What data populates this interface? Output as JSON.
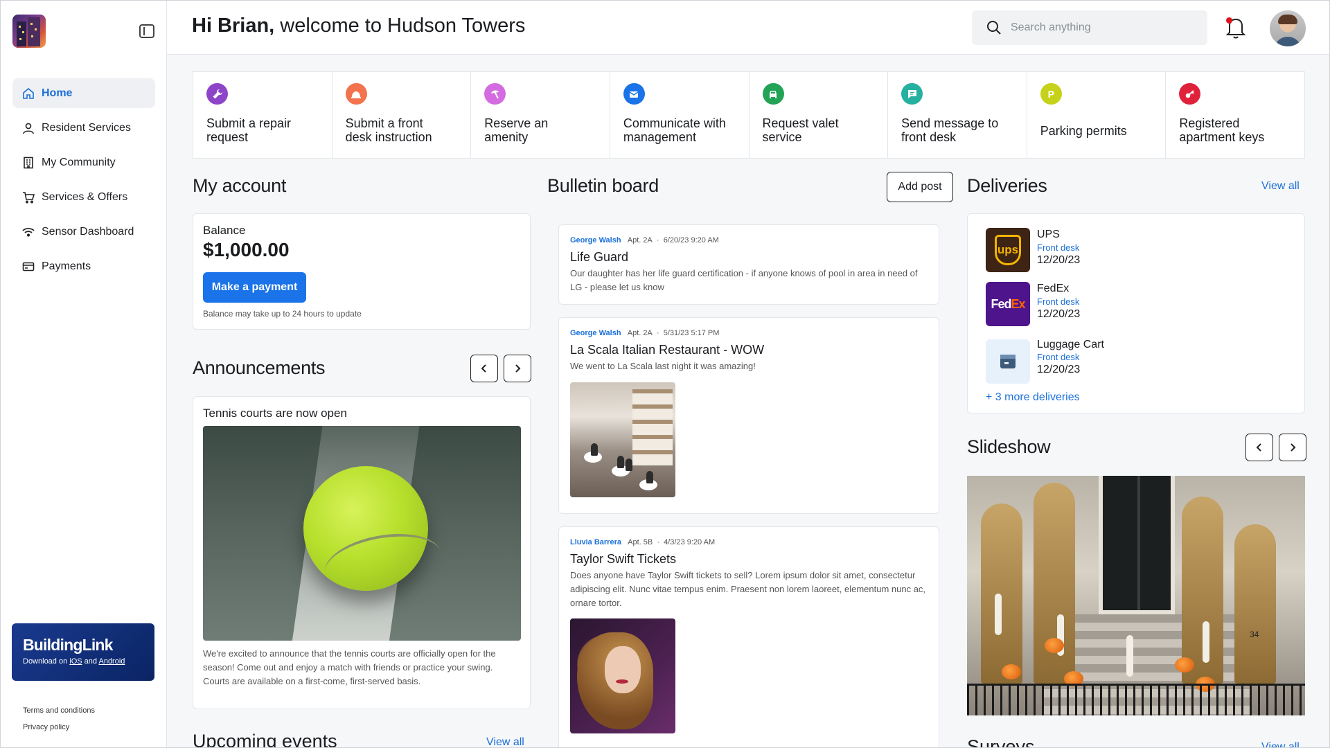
{
  "header": {
    "greeting_name": "Hi Brian,",
    "greeting_rest": " welcome to Hudson Towers",
    "search_placeholder": "Search anything"
  },
  "sidebar": {
    "items": [
      {
        "label": "Home",
        "icon": "home-icon",
        "active": true
      },
      {
        "label": "Resident Services",
        "icon": "person-icon"
      },
      {
        "label": "My Community",
        "icon": "building-icon"
      },
      {
        "label": "Services & Offers",
        "icon": "cart-icon"
      },
      {
        "label": "Sensor Dashboard",
        "icon": "wifi-icon"
      },
      {
        "label": "Payments",
        "icon": "card-icon"
      }
    ],
    "promo": {
      "title": "BuildingLink",
      "download_prefix": "Download on ",
      "ios": "iOS",
      "and": " and ",
      "android": "Android"
    },
    "legal": [
      "Terms and conditions",
      "Privacy policy"
    ]
  },
  "quick_actions": [
    {
      "label": "Submit a repair request",
      "color": "#8e44c9",
      "icon": "wrench-icon"
    },
    {
      "label": "Submit a front desk instruction",
      "color": "#f2734d",
      "icon": "bell-desk-icon"
    },
    {
      "label": "Reserve an amenity",
      "color": "#d46be0",
      "icon": "umbrella-icon"
    },
    {
      "label": "Communicate with management",
      "color": "#1a73e8",
      "icon": "mail-icon"
    },
    {
      "label": "Request valet service",
      "color": "#22a356",
      "icon": "car-icon"
    },
    {
      "label": "Send message to front desk",
      "color": "#26b0a0",
      "icon": "chat-icon"
    },
    {
      "label": "Parking permits",
      "color": "#c6d21a",
      "icon": "parking-icon",
      "glyph": "P"
    },
    {
      "label": "Registered apartment keys",
      "color": "#e0213a",
      "icon": "key-icon"
    }
  ],
  "account": {
    "title": "My account",
    "balance_label": "Balance",
    "balance": "$1,000.00",
    "pay_label": "Make a payment",
    "note": "Balance may take up to 24 hours to update"
  },
  "announcements": {
    "title": "Announcements",
    "item_title": "Tennis courts are now open",
    "item_text": "We're excited to announce that the tennis courts are officially open for the season! Come out and enjoy a match with friends or practice your swing. Courts are available on a first-come, first-served basis."
  },
  "upcoming": {
    "title": "Upcoming events",
    "view_all": "View all"
  },
  "bulletin": {
    "title": "Bulletin board",
    "add_label": "Add post",
    "posts": [
      {
        "author": "George Walsh",
        "apt": "Apt. 2A",
        "date": "6/20/23 9:20 AM",
        "title": "Life Guard",
        "body": "Our daughter has her life guard certification - if anyone knows of pool in area in need of LG - please let us know"
      },
      {
        "author": "George Walsh",
        "apt": "Apt. 2A",
        "date": "5/31/23 5:17 PM",
        "title": "La Scala Italian Restaurant - WOW",
        "body": "We went to La Scala last night it was amazing!"
      },
      {
        "author": "Lluvia Barrera",
        "apt": "Apt. 5B",
        "date": "4/3/23 9:20 AM",
        "title": "Taylor Swift Tickets",
        "body": "Does anyone have Taylor Swift tickets to sell? Lorem ipsum dolor sit amet, consectetur adipiscing elit. Nunc vitae tempus enim. Praesent non lorem laoreet, elementum nunc ac, ornare tortor."
      }
    ]
  },
  "deliveries": {
    "title": "Deliveries",
    "view_all": "View all",
    "items": [
      {
        "carrier": "UPS",
        "location": "Front desk",
        "date": "12/20/23",
        "logo_text": "ups"
      },
      {
        "carrier": "FedEx",
        "location": "Front desk",
        "date": "12/20/23",
        "logo_text_a": "Fed",
        "logo_text_b": "Ex"
      },
      {
        "carrier": "Luggage Cart",
        "location": "Front desk",
        "date": "12/20/23"
      }
    ],
    "more": "+ 3 more deliveries"
  },
  "slideshow": {
    "title": "Slideshow",
    "house_number": "34"
  },
  "surveys": {
    "title": "Surveys",
    "view_all": "View all"
  }
}
